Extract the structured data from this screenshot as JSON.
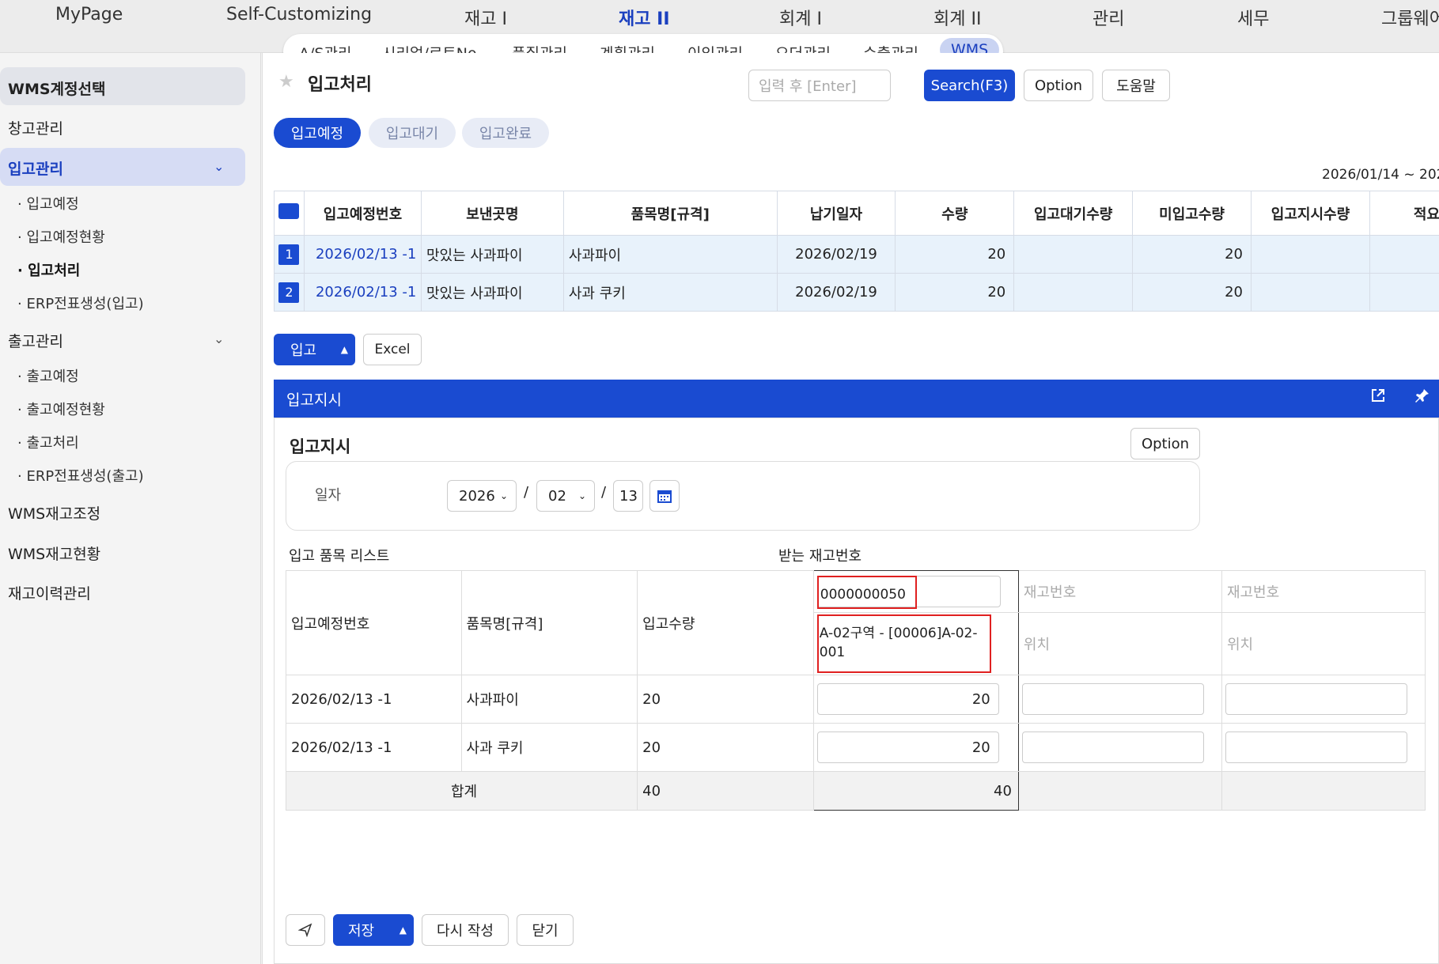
{
  "topnav": [
    "MyPage",
    "Self-Customizing",
    "재고 I",
    "재고 II",
    "회계 I",
    "회계 II",
    "관리",
    "세무",
    "그룹웨어"
  ],
  "subnav": [
    "A/S관리",
    "시리얼/로트No.",
    "품질관리",
    "계획관리",
    "이익관리",
    "오더관리",
    "수출관리",
    "WMS"
  ],
  "sidebar": {
    "account": "WMS계정선택",
    "warehouse": "창고관리",
    "inbound": "입고관리",
    "inbound_items": [
      "입고예정",
      "입고예정현황",
      "입고처리",
      "ERP전표생성(입고)"
    ],
    "outbound": "출고관리",
    "outbound_items": [
      "출고예정",
      "출고예정현황",
      "출고처리",
      "ERP전표생성(출고)"
    ],
    "adjust": "WMS재고조정",
    "status": "WMS재고현황",
    "history": "재고이력관리"
  },
  "page": {
    "title": "입고처리",
    "search_placeholder": "입력 후 [Enter]",
    "search_btn": "Search(F3)",
    "option_btn": "Option",
    "help_btn": "도움말",
    "tabs": [
      "입고예정",
      "입고대기",
      "입고완료"
    ],
    "date_range": "2026/01/14 ~ 202"
  },
  "grid": {
    "headers": [
      "입고예정번호",
      "보낸곳명",
      "품목명[규격]",
      "납기일자",
      "수량",
      "입고대기수량",
      "미입고수량",
      "입고지시수량",
      "적요"
    ],
    "rows": [
      {
        "n": "1",
        "no": "2026/02/13 -1",
        "from": "맛있는 사과파이",
        "item": "사과파이",
        "date": "2026/02/19",
        "qty": "20",
        "wait": "",
        "remain": "20"
      },
      {
        "n": "2",
        "no": "2026/02/13 -1",
        "from": "맛있는 사과파이",
        "item": "사과 쿠키",
        "date": "2026/02/19",
        "qty": "20",
        "wait": "",
        "remain": "20"
      }
    ]
  },
  "actions": {
    "inbound_btn": "입고",
    "excel_btn": "Excel"
  },
  "panel": {
    "header": "입고지시",
    "title": "입고지시",
    "option_btn": "Option",
    "date_label": "일자",
    "year": "2026",
    "month": "02",
    "day": "13",
    "list_label": "입고 품목 리스트",
    "recv_label": "받는 재고번호",
    "col_no": "입고예정번호",
    "col_item": "품목명[규격]",
    "col_qty": "입고수량",
    "stock_no": "0000000050",
    "stock_loc": "A-02구역 - [00006]A-02-001",
    "ph_stock": "재고번호",
    "ph_loc": "위치",
    "items": [
      {
        "no": "2026/02/13 -1",
        "item": "사과파이",
        "qty": "20",
        "recv": "20"
      },
      {
        "no": "2026/02/13 -1",
        "item": "사과 쿠키",
        "qty": "20",
        "recv": "20"
      }
    ],
    "total_label": "합계",
    "total_qty": "40",
    "total_recv": "40",
    "save_btn": "저장",
    "rewrite_btn": "다시 작성",
    "close_btn": "닫기"
  }
}
